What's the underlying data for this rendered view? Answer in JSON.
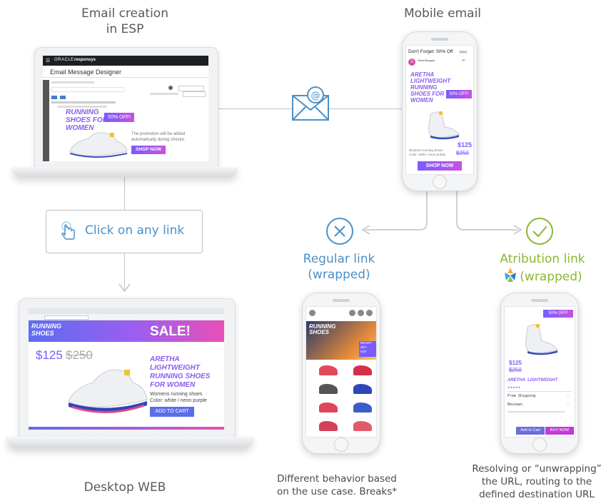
{
  "captions": {
    "email_creation": [
      "Email creation",
      "in ESP"
    ],
    "mobile_email": "Mobile email",
    "click_link": "Click on any link",
    "regular_link": [
      "Regular link",
      "(wrapped)"
    ],
    "attribution_link": [
      "Atribution link",
      "(wrapped)"
    ],
    "desktop_web": "Desktop WEB",
    "regular_note": [
      "Different behavior based",
      "on the use case. Breaks*"
    ],
    "attribution_note": [
      "Resolving or “unwrapping”",
      "the URL, routing to the",
      "defined destination URL"
    ]
  },
  "esp": {
    "brand_oracle": "ORACLE",
    "brand_responsys": "responsys",
    "designer_title": "Email Message Designer",
    "headline": [
      "RUNNING",
      "SHOES FOR",
      "WOMEN"
    ],
    "badge": "50% OFF!",
    "note": [
      "The promotion will be added",
      "automatically during checko"
    ],
    "cta": "SHOP NOW"
  },
  "mobile": {
    "subject": "Don't Forget: 50% Off",
    "inbox_tag": "Inbox",
    "sender_initial": "S",
    "sender": "ShoeShopper",
    "headline": [
      "ARETHA",
      "LIGHTWEIGHT",
      "RUNNING",
      "SHOES FOR",
      "WOMEN"
    ],
    "badge": "50% OFF!",
    "price": "$125",
    "old_price": "$250",
    "desc": [
      "Womens running shoes",
      "Color: white / neon purple"
    ],
    "cta": "SHOP NOW"
  },
  "desktop": {
    "banner_title": [
      "RUNNING",
      "SHOES"
    ],
    "sale": "SALE!",
    "price": "$125",
    "old_price": "$250",
    "product": [
      "ARETHA",
      "LIGHTWEIGHT",
      "RUNNING SHOES",
      "FOR WOMEN"
    ],
    "desc": [
      "Womens running shoes",
      "Color: white / neon purple"
    ],
    "cta": "ADD TO CART"
  },
  "regular_phone": {
    "banner": [
      "RUNNING",
      "SHOES"
    ],
    "ready": [
      "READY",
      "SET",
      "GO!"
    ]
  },
  "attr_phone": {
    "badge": "50% OFF!",
    "price": "$125",
    "old_price": "$250",
    "product": "ARETHA  LIGHTWEIGHT",
    "shipping": "Free Shipping",
    "reviews": "Reviews",
    "add_cart": "Add to Cart",
    "buy_now": "BUY NOW"
  },
  "colors": {
    "accent_blue": "#4a90c8",
    "accent_green": "#8ab832",
    "brand_purple": "#7a5cff"
  }
}
